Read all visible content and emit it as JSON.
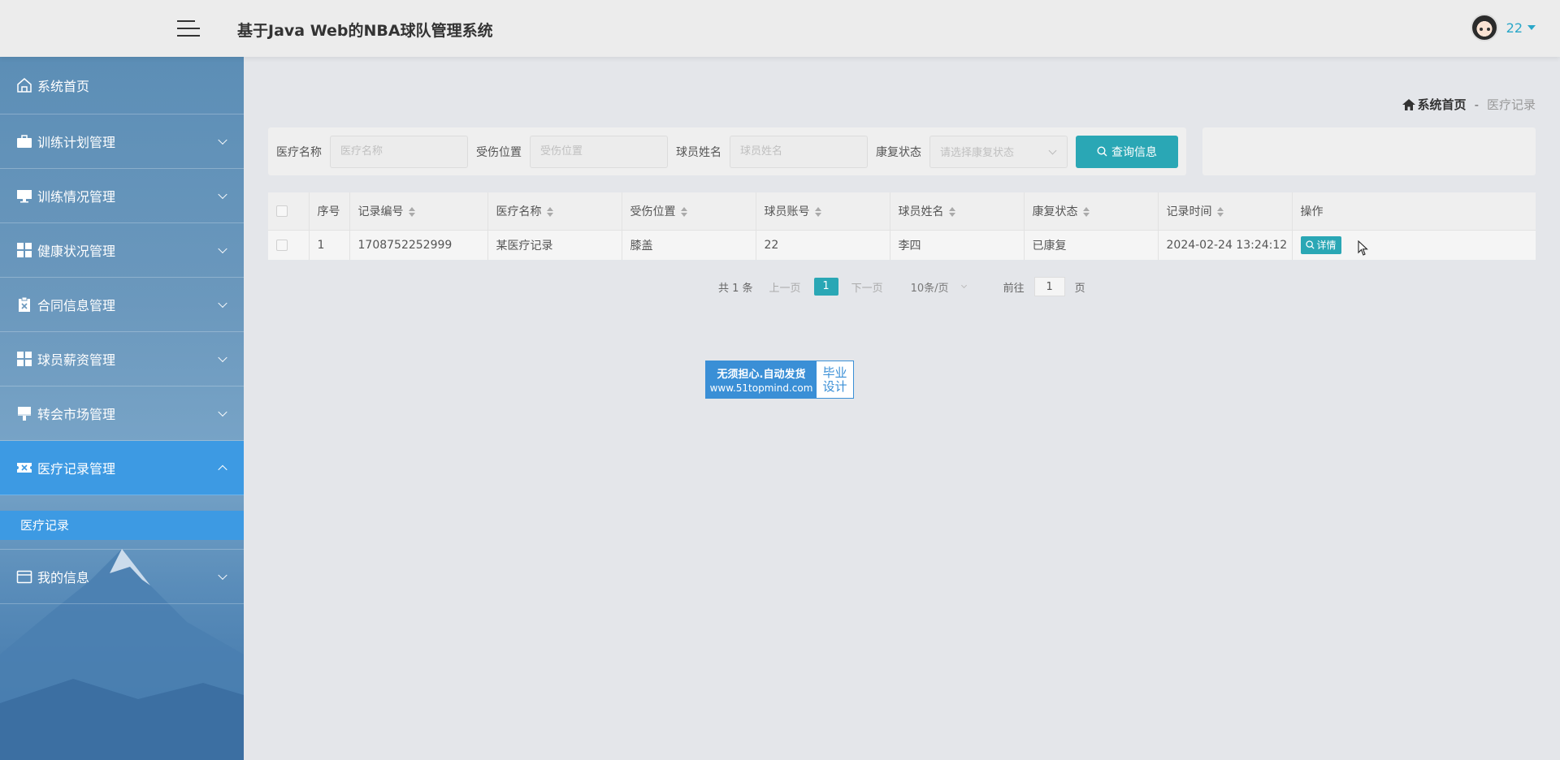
{
  "header": {
    "title": "基于Java Web的NBA球队管理系统",
    "username": "22"
  },
  "sidebar": {
    "items": [
      {
        "label": "系统首页",
        "icon": "home-icon"
      },
      {
        "label": "训练计划管理",
        "icon": "briefcase-icon"
      },
      {
        "label": "训练情况管理",
        "icon": "monitor-icon"
      },
      {
        "label": "健康状况管理",
        "icon": "grid-icon"
      },
      {
        "label": "合同信息管理",
        "icon": "clipboard-icon"
      },
      {
        "label": "球员薪资管理",
        "icon": "grid-icon"
      },
      {
        "label": "转会市场管理",
        "icon": "brush-icon"
      },
      {
        "label": "医疗记录管理",
        "icon": "ticket-icon"
      },
      {
        "label": "我的信息",
        "icon": "wallet-icon"
      }
    ],
    "submenu": {
      "label": "医疗记录"
    }
  },
  "breadcrumb": {
    "home": "系统首页",
    "separator": "-",
    "current": "医疗记录"
  },
  "search": {
    "fields": [
      {
        "label": "医疗名称",
        "placeholder": "医疗名称"
      },
      {
        "label": "受伤位置",
        "placeholder": "受伤位置"
      },
      {
        "label": "球员姓名",
        "placeholder": "球员姓名"
      }
    ],
    "status": {
      "label": "康复状态",
      "placeholder": "请选择康复状态"
    },
    "button": "查询信息"
  },
  "table": {
    "columns": [
      "序号",
      "记录编号",
      "医疗名称",
      "受伤位置",
      "球员账号",
      "球员姓名",
      "康复状态",
      "记录时间",
      "操作"
    ],
    "rows": [
      {
        "index": "1",
        "record_no": "1708752252999",
        "medical_name": "某医疗记录",
        "injury_location": "膝盖",
        "player_account": "22",
        "player_name": "李四",
        "status": "已康复",
        "time": "2024-02-24 13:24:12",
        "action": "详情"
      }
    ]
  },
  "pagination": {
    "total": "共 1 条",
    "prev": "上一页",
    "current": "1",
    "next": "下一页",
    "page_size": "10条/页",
    "goto_label": "前往",
    "goto_value": "1",
    "page_unit": "页"
  },
  "watermark": {
    "line1": "无须担心.自动发货",
    "line2": "www.51topmind.com",
    "right1": "毕业",
    "right2": "设计"
  },
  "colors": {
    "accent": "#2aa7b5",
    "sidebar_active": "#3d9ae3",
    "username": "#2aa7c9"
  }
}
